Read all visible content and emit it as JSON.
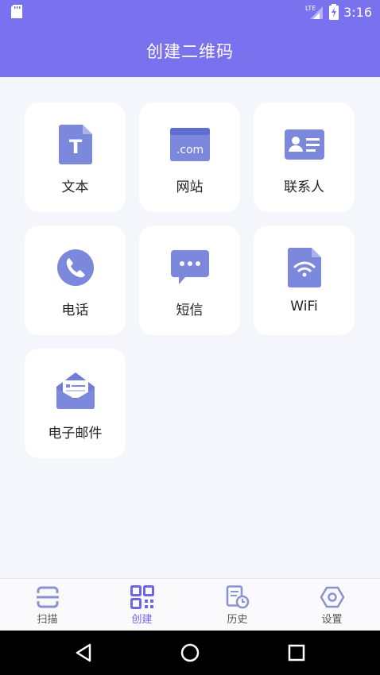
{
  "status_bar": {
    "time": "3:16",
    "network_label": "LTE"
  },
  "app_bar": {
    "title": "创建二维码"
  },
  "tiles": [
    {
      "label": "文本",
      "icon": "text-document-icon",
      "icon_letter": "T"
    },
    {
      "label": "网站",
      "icon": "website-icon",
      "icon_text": ".com"
    },
    {
      "label": "联系人",
      "icon": "contact-card-icon"
    },
    {
      "label": "电话",
      "icon": "phone-icon"
    },
    {
      "label": "短信",
      "icon": "sms-icon"
    },
    {
      "label": "WiFi",
      "icon": "wifi-document-icon"
    },
    {
      "label": "电子邮件",
      "icon": "email-icon"
    }
  ],
  "bottom_nav": [
    {
      "label": "扫描",
      "icon": "scan-icon",
      "active": false
    },
    {
      "label": "创建",
      "icon": "qr-code-icon",
      "active": true
    },
    {
      "label": "历史",
      "icon": "history-icon",
      "active": false
    },
    {
      "label": "设置",
      "icon": "settings-icon",
      "active": false
    }
  ],
  "colors": {
    "primary": "#7a71ef",
    "icon": "#7b88dc",
    "background": "#f5f6fb",
    "active_nav": "#6f66e6"
  }
}
